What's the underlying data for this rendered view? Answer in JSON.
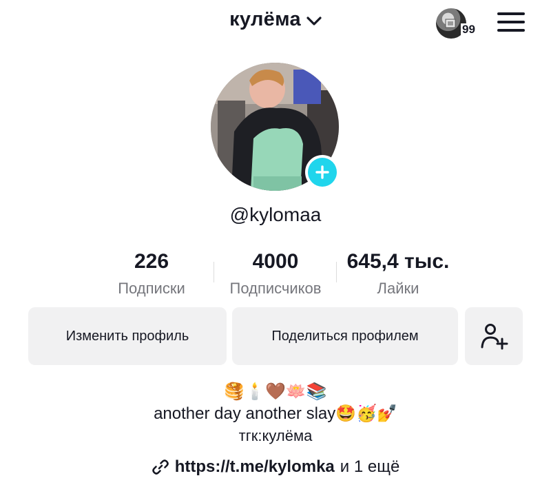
{
  "header": {
    "username_title": "кулёма",
    "notifications_count": "99",
    "icons": {
      "switch": "chevron-down-icon",
      "menu": "hamburger-menu-icon"
    }
  },
  "profile": {
    "handle": "@kylomaa",
    "stats": [
      {
        "value": "226",
        "label": "Подписки"
      },
      {
        "value": "4000",
        "label": "Подписчиков"
      },
      {
        "value": "645,4 тыс.",
        "label": "Лайки"
      }
    ]
  },
  "actions": {
    "edit_profile": "Изменить профиль",
    "share_profile": "Поделиться профилем",
    "add_friend_icon": "add-user-icon"
  },
  "bio": {
    "emoji_line": "🥞🕯️🤎🪷📚",
    "line1": "another day another slay🤩🥳💅",
    "line2": "тгк:кулёма"
  },
  "link": {
    "url": "https://t.me/kylomka",
    "more": "и 1 ещё",
    "icon": "link-icon"
  },
  "colors": {
    "accent": "#20d5ec",
    "button_bg": "#f1f1f2",
    "secondary_text": "#75767c"
  }
}
